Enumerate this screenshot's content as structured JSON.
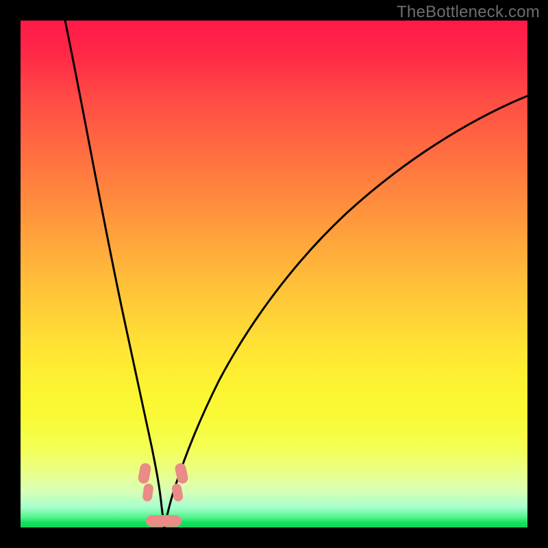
{
  "watermark": "TheBottleneck.com",
  "colors": {
    "frame": "#000000",
    "marker": "#ea8b87",
    "curve": "#000000",
    "gradient_top": "#ff1948",
    "gradient_bottom": "#0fd559"
  },
  "chart_data": {
    "type": "line",
    "title": "",
    "xlabel": "",
    "ylabel": "",
    "xlim": [
      0,
      100
    ],
    "ylim": [
      0,
      100
    ],
    "x": [
      0,
      2,
      5,
      8,
      11,
      14,
      17,
      20,
      22,
      24,
      26,
      27,
      28,
      29,
      30,
      32,
      34,
      37,
      40,
      44,
      50,
      58,
      66,
      75,
      85,
      95,
      100
    ],
    "series": [
      {
        "name": "bottleneck-curve",
        "values": [
          100,
          88,
          72,
          58,
          46,
          35,
          24,
          14,
          8,
          4,
          1.5,
          0.5,
          0,
          0.3,
          1.2,
          3.5,
          8,
          15,
          23,
          33,
          46,
          59,
          68,
          76,
          83,
          88,
          90
        ]
      }
    ],
    "annotations": [
      {
        "name": "marker-left-upper",
        "x": 24.5,
        "y": 9.5
      },
      {
        "name": "marker-left-lower",
        "x": 25.0,
        "y": 6.0
      },
      {
        "name": "marker-right-upper",
        "x": 31.5,
        "y": 9.5
      },
      {
        "name": "marker-right-lower",
        "x": 31.0,
        "y": 6.0
      },
      {
        "name": "marker-bottom",
        "x": 28.0,
        "y": 0.8
      }
    ]
  }
}
